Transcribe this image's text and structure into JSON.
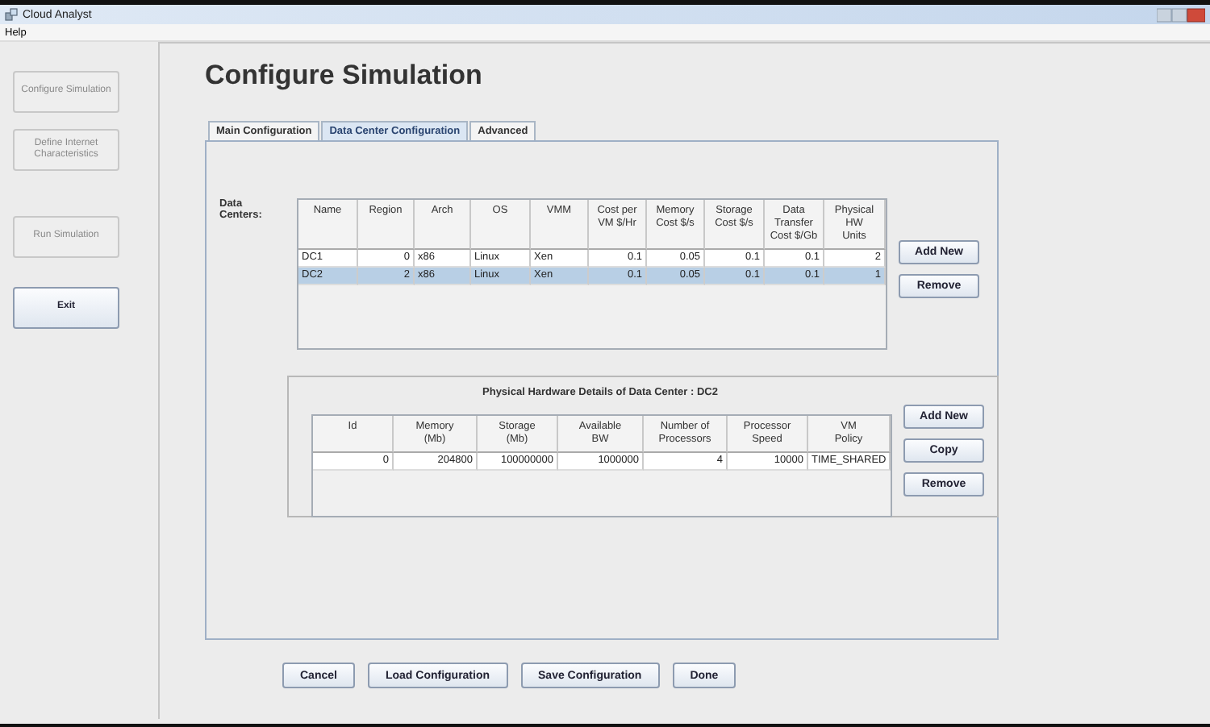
{
  "window": {
    "title": "Cloud Analyst"
  },
  "menu": [
    {
      "label": "Help"
    }
  ],
  "sidebar": {
    "buttons": [
      {
        "label": "Configure Simulation",
        "disabled": true
      },
      {
        "label": "Define Internet Characteristics",
        "disabled": true
      },
      {
        "label": "Run Simulation",
        "disabled": true
      },
      {
        "label": "Exit",
        "disabled": false
      }
    ]
  },
  "heading": "Configure Simulation",
  "tabs": [
    {
      "label": "Main Configuration",
      "selected": false
    },
    {
      "label": "Data Center Configuration",
      "selected": true
    },
    {
      "label": "Advanced",
      "selected": false
    }
  ],
  "data_centers": {
    "label": "Data\nCenters:",
    "columns": [
      {
        "label": "Name",
        "kind": "text"
      },
      {
        "label": "Region",
        "kind": "number"
      },
      {
        "label": "Arch",
        "kind": "text"
      },
      {
        "label": "OS",
        "kind": "text"
      },
      {
        "label": "VMM",
        "kind": "text"
      },
      {
        "label": "Cost per\nVM $/Hr",
        "kind": "number"
      },
      {
        "label": "Memory\nCost $/s",
        "kind": "number"
      },
      {
        "label": "Storage\nCost $/s",
        "kind": "number"
      },
      {
        "label": "Data\nTransfer\nCost $/Gb",
        "kind": "number"
      },
      {
        "label": "Physical\nHW\nUnits",
        "kind": "number"
      }
    ],
    "rows": [
      {
        "selected": false,
        "cells": [
          "DC1",
          "0",
          "x86",
          "Linux",
          "Xen",
          "0.1",
          "0.05",
          "0.1",
          "0.1",
          "2"
        ]
      },
      {
        "selected": true,
        "cells": [
          "DC2",
          "2",
          "x86",
          "Linux",
          "Xen",
          "0.1",
          "0.05",
          "0.1",
          "0.1",
          "1"
        ]
      }
    ],
    "buttons": [
      "Add New",
      "Remove"
    ]
  },
  "hardware": {
    "title": "Physical Hardware Details of Data Center : DC2",
    "columns": [
      {
        "label": "Id",
        "kind": "number"
      },
      {
        "label": "Memory\n(Mb)",
        "kind": "number"
      },
      {
        "label": "Storage\n(Mb)",
        "kind": "number"
      },
      {
        "label": "Available\nBW",
        "kind": "number"
      },
      {
        "label": "Number of\nProcessors",
        "kind": "number"
      },
      {
        "label": "Processor\nSpeed",
        "kind": "number"
      },
      {
        "label": "VM\nPolicy",
        "kind": "text"
      }
    ],
    "rows": [
      {
        "selected": false,
        "cells": [
          "0",
          "204800",
          "100000000",
          "1000000",
          "4",
          "10000",
          "TIME_SHARED"
        ]
      }
    ],
    "buttons": [
      "Add New",
      "Copy",
      "Remove"
    ]
  },
  "footer_buttons": [
    "Cancel",
    "Load Configuration",
    "Save Configuration",
    "Done"
  ]
}
